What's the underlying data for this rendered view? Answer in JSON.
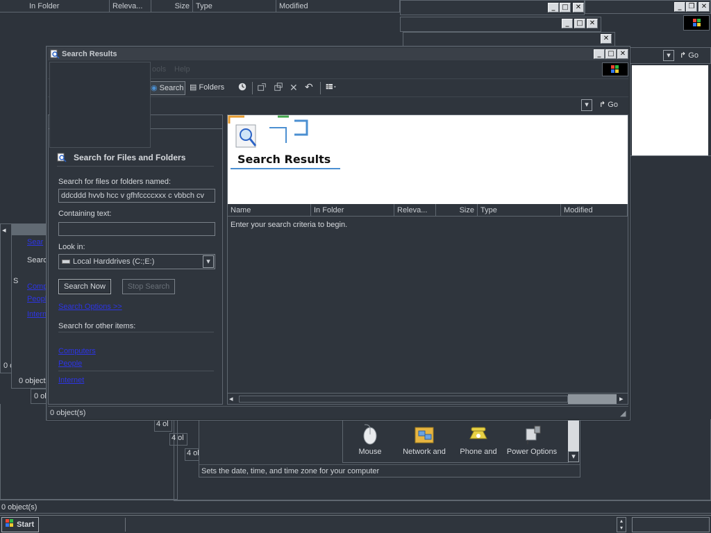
{
  "background_windows": {
    "top_headers": [
      "In Folder",
      "Releva...",
      "Size",
      "Type",
      "Modified"
    ],
    "top_right_go": "Go",
    "left_panel_items": [
      "Searc",
      "Searc",
      "S",
      "Comp",
      "Peopl",
      "Intern"
    ],
    "status_counts": [
      "0 o",
      "0 object",
      "0 ol",
      "4 ol",
      "4 ol",
      "4 ol"
    ],
    "bottom_status": "0 object(s)",
    "control_panel": {
      "icons": [
        {
          "label": "Mouse",
          "icon": "mouse-icon"
        },
        {
          "label": "Network and",
          "icon": "network-icon"
        },
        {
          "label": "Phone and",
          "icon": "phone-icon"
        },
        {
          "label": "Power Options",
          "icon": "power-icon"
        }
      ],
      "status": "Sets the date, time, and time zone for your computer"
    }
  },
  "window": {
    "title": "Search Results",
    "menu_items": [
      "ools",
      "Help"
    ],
    "toolbar": {
      "search_label": "Search",
      "folders_label": "Folders"
    },
    "go_label": "Go",
    "status": "0 object(s)"
  },
  "search_pane": {
    "heading": "Search for Files and Folders",
    "named_label": "Search for files or folders named:",
    "named_value": "ddcddd hvvb  hcc v  gfhfccccxxx c vbbch cv",
    "containing_label": "Containing text:",
    "containing_value": "",
    "lookin_label": "Look in:",
    "lookin_value": "Local Harddrives (C:;E:)",
    "search_now": "Search Now",
    "stop_search": "Stop Search",
    "search_options": "Search Options  >>",
    "other_items_label": "Search for other items:",
    "other_links": [
      "Computers",
      "People",
      "Internet"
    ]
  },
  "results": {
    "banner_title": "Search Results",
    "columns": [
      "Name",
      "In Folder",
      "Releva...",
      "Size",
      "Type",
      "Modified"
    ],
    "empty_message": "Enter your search criteria to begin."
  },
  "taskbar": {
    "start_label": "Start"
  },
  "colors": {
    "bg": "#2d333b",
    "link": "#2d35e6",
    "banner_bg": "#ffffff",
    "banner_accent_orange": "#e59a2e",
    "banner_accent_blue": "#4b8fd1"
  }
}
